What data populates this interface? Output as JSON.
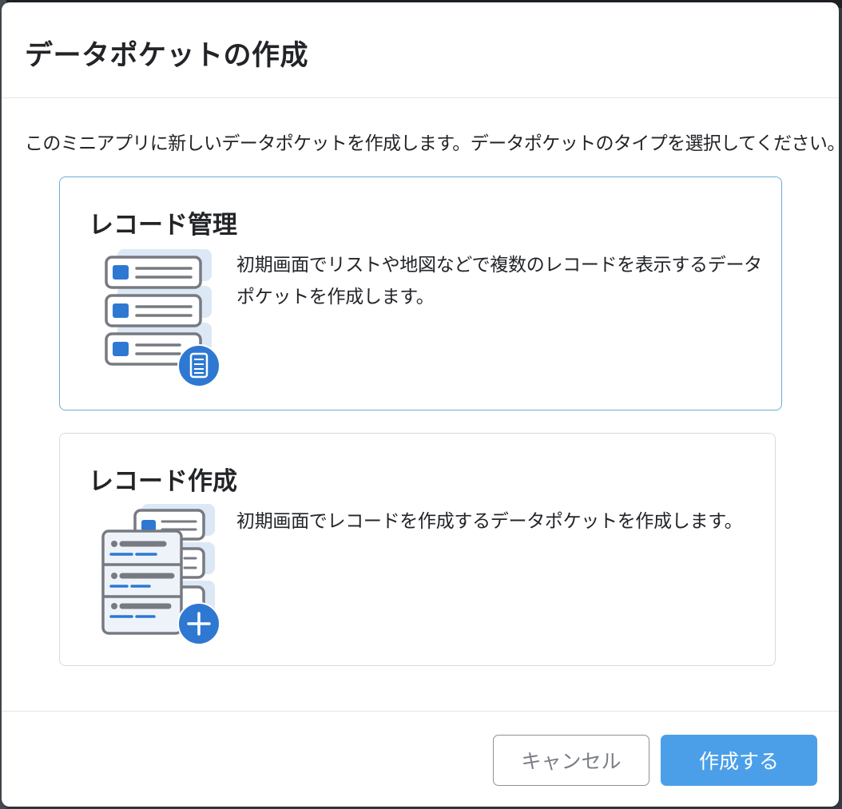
{
  "dialog": {
    "title": "データポケットの作成",
    "description": "このミニアプリに新しいデータポケットを作成します。データポケットのタイプを選択してください。"
  },
  "options": [
    {
      "title": "レコード管理",
      "description": "初期画面でリストや地図などで複数のレコードを表示するデータポケットを作成します。",
      "icon": "record-list-icon",
      "selected": true
    },
    {
      "title": "レコード作成",
      "description": "初期画面でレコードを作成するデータポケットを作成します。",
      "icon": "record-create-icon",
      "selected": false
    }
  ],
  "footer": {
    "cancel_label": "キャンセル",
    "create_label": "作成する"
  },
  "colors": {
    "accent": "#4a9fe8",
    "icon_blue": "#2e78d2",
    "selected_border": "#6aaed6"
  }
}
